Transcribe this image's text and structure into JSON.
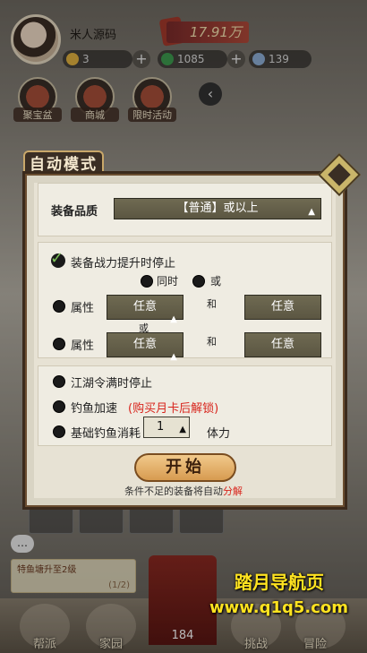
{
  "hud": {
    "player_name": "米人源码",
    "power": "17.91万",
    "resources": [
      {
        "value": "3",
        "icon": "gold-ingot-icon",
        "color": "#e3b341"
      },
      {
        "value": "1085",
        "icon": "jade-icon",
        "color": "#3e9b4f"
      },
      {
        "value": "139",
        "icon": "feather-icon",
        "color": "#8fb0d9"
      }
    ],
    "quick_buttons": [
      "聚宝盆",
      "商城",
      "限时活动"
    ],
    "quest_title": "特鱼塘升至2级",
    "quest_progress": "(1/2)",
    "gate_count": "184",
    "nav": [
      "帮派",
      "家园",
      "挑战",
      "冒险"
    ]
  },
  "watermark": {
    "line1": "踏月导航页",
    "line2": "www.q1q5.com"
  },
  "dialog": {
    "title": "自动模式",
    "quality_label": "装备品质",
    "quality_value": "【普通】或以上",
    "power_stop_label": "装备战力提升时停止",
    "opt_same": "同时",
    "opt_or": "或",
    "attr_label": "属性",
    "any": "任意",
    "and": "和",
    "or_between": "或",
    "jianghu_stop_label": "江湖令满时停止",
    "fishing_speed_label": "钓鱼加速",
    "fishing_speed_note": "(购买月卡后解锁)",
    "base_cost_label": "基础钓鱼消耗",
    "base_cost_value": "1",
    "stamina_unit": "体力",
    "start_button": "开始",
    "footer_text": "条件不足的装备将自动",
    "footer_highlight": "分解"
  }
}
